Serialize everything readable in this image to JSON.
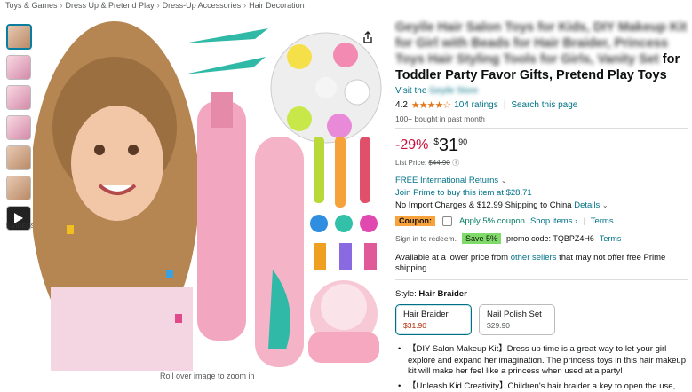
{
  "breadcrumb": [
    "Toys & Games",
    "Dress Up & Pretend Play",
    "Dress-Up Accessories",
    "Hair Decoration"
  ],
  "gallery": {
    "video_label": "5 VIDEOS",
    "zoom_hint": "Roll over image to zoom in"
  },
  "product": {
    "title_blurred_a": "Geyile Hair Salon Toys for Kids, DIY Makeup Kit",
    "title_blurred_b": "for Girl with Beads for Hair Braider, Princess",
    "title_blurred_c": "Toys Hair Styling Tools for Girls, Vanity Set",
    "title_clear_c": " for",
    "title_clear_d": "Toddler Party Favor Gifts, Pretend Play Toys",
    "visit_prefix": "Visit the",
    "visit_brand": "Geyile Store",
    "rating_value": "4.2",
    "stars": "★★★★☆",
    "ratings_count": "104 ratings",
    "search_link": "Search this page",
    "bought": "100+ bought in past month"
  },
  "price": {
    "discount": "-29%",
    "symbol": "$",
    "whole": "31",
    "fraction": "90",
    "list_label": "List Price:",
    "list_price": "$44.90",
    "info_icon": "info-circle-icon"
  },
  "shipping": {
    "free_intl": "FREE International Returns",
    "prime": "Join Prime to buy this item at $28.71",
    "import_text": "No Import Charges & $12.99 Shipping to China",
    "details": "Details"
  },
  "coupon": {
    "badge": "Coupon:",
    "apply": "Apply 5% coupon",
    "shop_items": "Shop items ›",
    "terms": "Terms"
  },
  "promo": {
    "signin": "Sign in to redeem.",
    "save_badge": "Save 5%",
    "code_text": "promo code: TQBPZ4H6",
    "terms": "Terms"
  },
  "availability": {
    "prefix": "Available at a lower price from",
    "link": "other sellers",
    "suffix": "that may not offer free Prime shipping."
  },
  "style": {
    "label": "Style:",
    "selected": "Hair Braider",
    "options": [
      {
        "name": "Hair Braider",
        "price": "$31.90"
      },
      {
        "name": "Nail Polish Set",
        "price": "$29.90"
      }
    ]
  },
  "bullets": [
    "【DIY Salon Makeup Kit】Dress up time is a great way to let your girl explore and expand her imagination. The princess toys in this hair makeup kit will make her feel like a princess when used at a party!",
    "【Unleash Kid Creativity】Children's hair braider a key to open the use,"
  ],
  "colors": {
    "accent": "#007185",
    "price_red": "#cc0c39",
    "coupon_orange": "#f7a23b",
    "save_green": "#7fda69",
    "star": "#de7921"
  }
}
